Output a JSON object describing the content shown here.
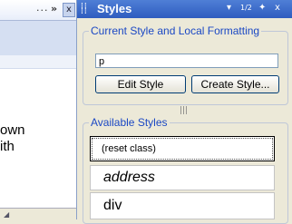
{
  "left_pane": {
    "tab_dots": "...",
    "tab_chevron": "»",
    "close_glyph": "x",
    "text_lines": [
      "own",
      "ith"
    ]
  },
  "panel": {
    "title": "Styles",
    "title_icons": {
      "dropdown": "▾",
      "page_indicator": "1/2",
      "pin": "✦",
      "close": "x"
    }
  },
  "current_style": {
    "group_label": "Current Style and Local Formatting",
    "value": "p",
    "edit_button": "Edit Style",
    "create_button": "Create Style..."
  },
  "splitter_glyph": "|||",
  "available_styles": {
    "group_label": "Available Styles",
    "items": [
      {
        "label": "(reset class)",
        "selected": true
      },
      {
        "label": "address",
        "selected": false
      },
      {
        "label": "div",
        "selected": false
      }
    ]
  },
  "colors": {
    "title_bar": "#2e5cbf",
    "group_label": "#1b48c4",
    "panel_bg": "#ece9d8"
  }
}
